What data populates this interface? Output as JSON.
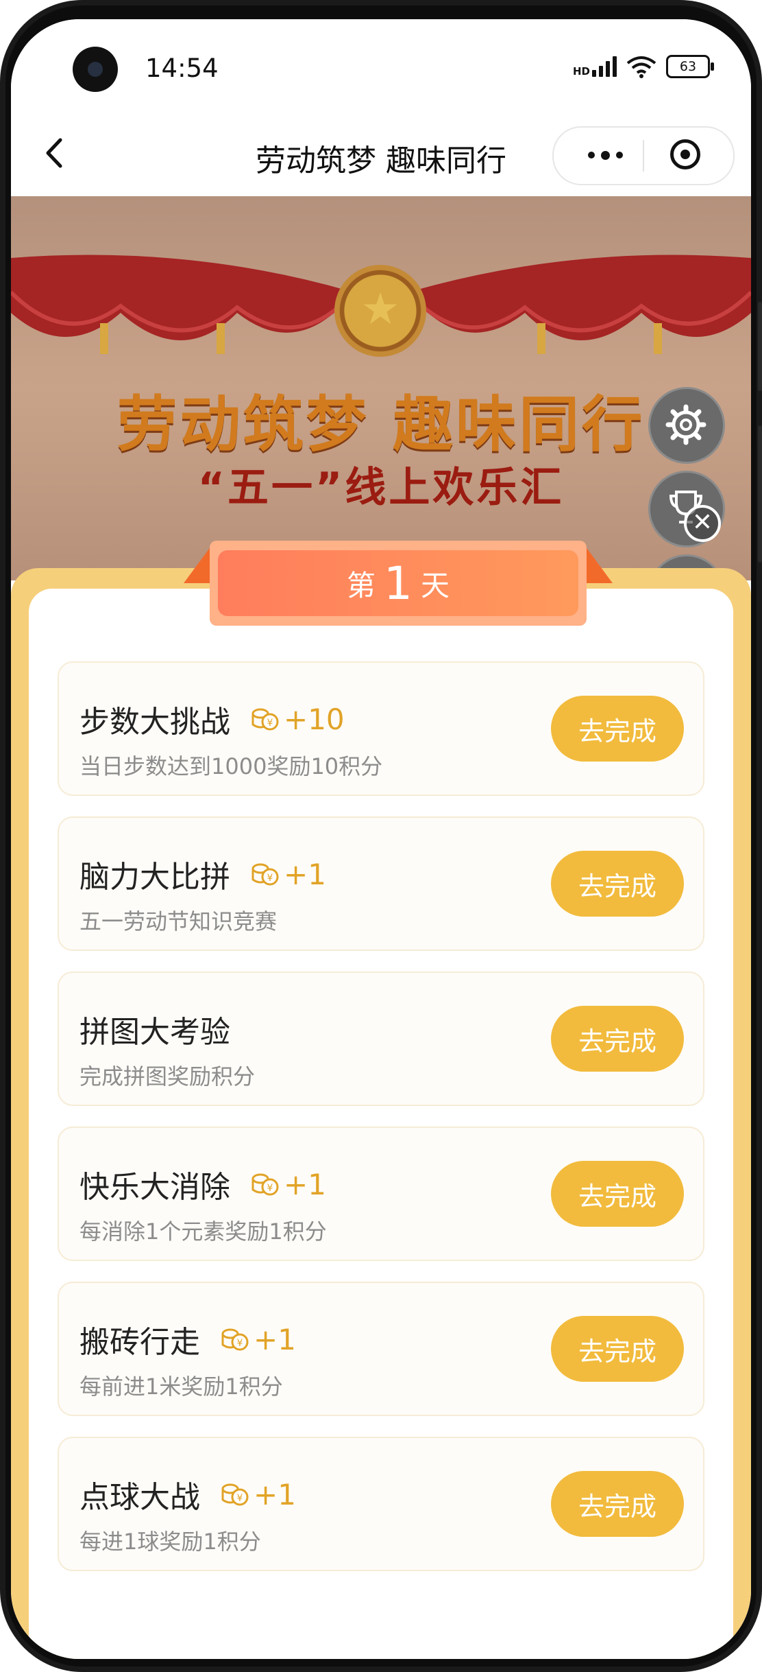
{
  "status_bar": {
    "time": "14:54",
    "network": "HD",
    "battery": "63"
  },
  "nav": {
    "title": "劳动筑梦 趣味同行"
  },
  "banner": {
    "title": "劳动筑梦 趣味同行",
    "subtitle": "“五一”线上欢乐汇"
  },
  "day_tab": {
    "prefix": "第",
    "number": "1",
    "suffix": "天"
  },
  "tasks": [
    {
      "title": "步数大挑战",
      "reward": "+10",
      "desc": "当日步数达到1000奖励10积分",
      "button": "去完成"
    },
    {
      "title": "脑力大比拼",
      "reward": "+1",
      "desc": "五一劳动节知识竞赛",
      "button": "去完成"
    },
    {
      "title": "拼图大考验",
      "reward": "",
      "desc": "完成拼图奖励积分",
      "button": "去完成"
    },
    {
      "title": "快乐大消除",
      "reward": "+1",
      "desc": "每消除1个元素奖励1积分",
      "button": "去完成"
    },
    {
      "title": "搬砖行走",
      "reward": "+1",
      "desc": "每前进1米奖励1积分",
      "button": "去完成"
    },
    {
      "title": "点球大战",
      "reward": "+1",
      "desc": "每进1球奖励1积分",
      "button": "去完成"
    }
  ],
  "floating": {
    "gear_icon": "gear-icon",
    "trophy_icon": "trophy-icon",
    "close_icon": "close-icon"
  },
  "colors": {
    "accent": "#f2bb3d",
    "reward": "#e1a327",
    "sheet": "#f6cf7b",
    "day_tab": "#ff7d5c"
  }
}
